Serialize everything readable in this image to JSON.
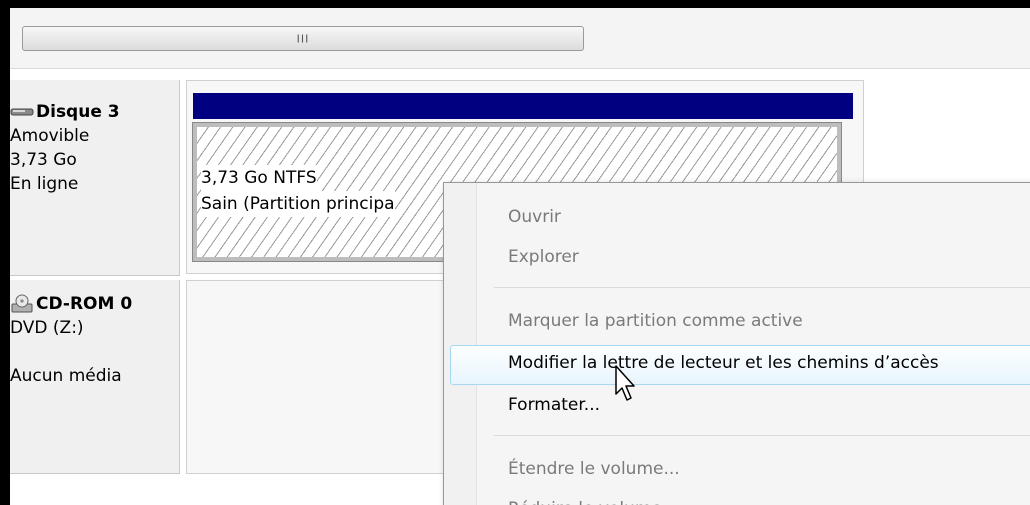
{
  "scrollbar": {
    "grip": "III"
  },
  "disks": [
    {
      "name": "Disque 3",
      "type": "Amovible",
      "size": "3,73 Go",
      "status": "En ligne",
      "icon": "removable-disk-icon",
      "partition": {
        "size_fs": "3,73 Go NTFS",
        "status": "Sain (Partition principa"
      }
    },
    {
      "name": "CD-ROM 0",
      "type": "DVD (Z:)",
      "status": "Aucun média",
      "icon": "cd-rom-icon"
    }
  ],
  "context_menu": {
    "items": [
      {
        "label": "Ouvrir",
        "enabled": false
      },
      {
        "label": "Explorer",
        "enabled": false
      },
      {
        "label": "Marquer la partition comme active",
        "enabled": false
      },
      {
        "label": "Modifier la lettre de lecteur et les chemins d’accès",
        "enabled": true,
        "highlighted": true
      },
      {
        "label": "Formater...",
        "enabled": true
      },
      {
        "label": "Étendre le volume...",
        "enabled": false
      },
      {
        "label": "Réduire le volume...",
        "enabled": false
      }
    ]
  },
  "colors": {
    "volume_bar": "#000080",
    "highlight_border": "#a8d8f0",
    "disabled_text": "#7a7a7a"
  }
}
